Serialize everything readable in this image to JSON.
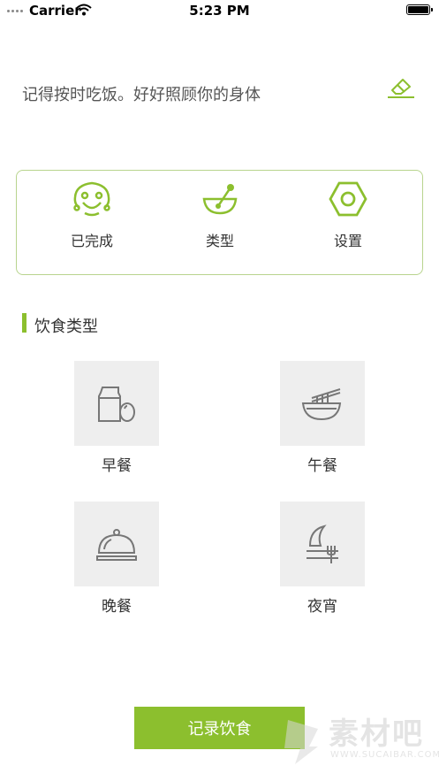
{
  "status_bar": {
    "carrier": "Carrier",
    "time": "5:23 PM"
  },
  "header": {
    "motto": "记得按时吃饭。好好照顾你的身体",
    "clear_icon": "eraser-icon"
  },
  "shortcuts": [
    {
      "label": "已完成",
      "icon": "smiley-icon"
    },
    {
      "label": "类型",
      "icon": "bowl-spoon-icon"
    },
    {
      "label": "设置",
      "icon": "hex-nut-icon"
    }
  ],
  "section": {
    "title": "饮食类型"
  },
  "meals": [
    {
      "label": "早餐",
      "icon": "bottle-egg-icon"
    },
    {
      "label": "午餐",
      "icon": "noodle-bowl-icon"
    },
    {
      "label": "晚餐",
      "icon": "cloche-icon"
    },
    {
      "label": "夜宵",
      "icon": "moon-fork-icon"
    }
  ],
  "actions": {
    "record_label": "记录饮食"
  },
  "watermark": {
    "text": "素材吧",
    "url": "WWW.SUCAIBAR.COM"
  },
  "colors": {
    "accent": "#8cbf2e",
    "tile_bg": "#eeeeee",
    "card_border": "#b8d48e"
  }
}
